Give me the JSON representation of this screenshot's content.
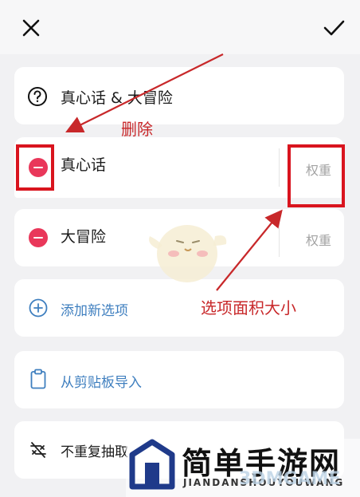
{
  "header": {
    "close_icon": "close-icon",
    "confirm_icon": "check-icon"
  },
  "title_card": {
    "icon": "question-circle-icon",
    "text": "真心话 & 大冒险"
  },
  "options": [
    {
      "label": "真心话",
      "weight_label": "权重",
      "icon": "minus-circle-icon"
    },
    {
      "label": "大冒险",
      "weight_label": "权重",
      "icon": "minus-circle-icon"
    }
  ],
  "actions": {
    "add_option": {
      "label": "添加新选项",
      "icon": "plus-circle-icon"
    },
    "import_clipboard": {
      "label": "从剪贴板导入",
      "icon": "clipboard-icon"
    },
    "no_repeat": {
      "label": "不重复抽取",
      "icon": "shuffle-off-icon"
    }
  },
  "annotations": {
    "delete": "删除",
    "option_area_size": "选项面积大小"
  },
  "watermark": {
    "title": "简单手游网",
    "subtitle": "JIANDANSHOUYOUWANG",
    "brand": "3DMGAME"
  },
  "colors": {
    "accent_blue": "#3f7fbf",
    "delete_red": "#e9375a",
    "annotation_red": "#c8282a"
  }
}
